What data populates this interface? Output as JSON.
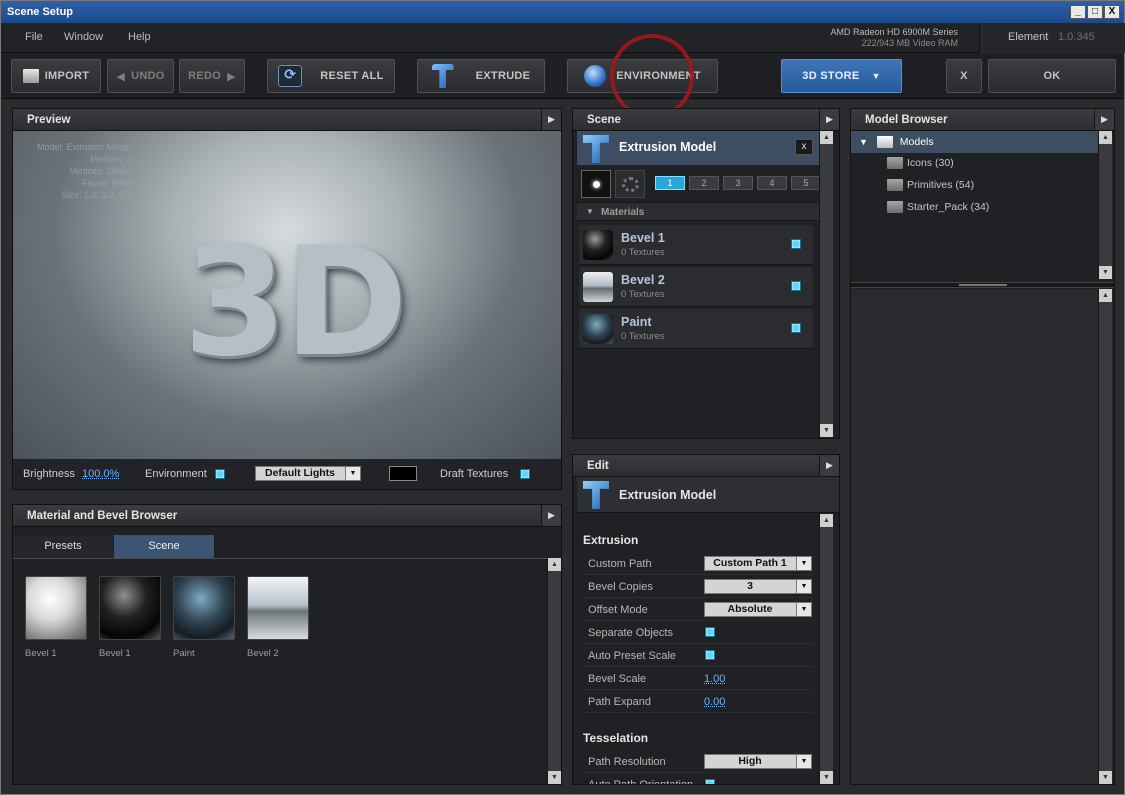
{
  "window": {
    "title": "Scene Setup",
    "controls": [
      "_",
      "□",
      "X"
    ]
  },
  "menu": {
    "items": [
      "File",
      "Window",
      "Help"
    ]
  },
  "gpu": {
    "name": "AMD Radeon HD 6900M Series",
    "memory": "222/943 MB Video RAM"
  },
  "app": {
    "name": "Element",
    "version": "1.0.345"
  },
  "toolbar": {
    "import": "IMPORT",
    "undo": "UNDO",
    "redo": "REDO",
    "reset_all": "RESET ALL",
    "extrude": "EXTRUDE",
    "environment": "ENVIRONMENT",
    "store": "3D STORE",
    "close": "X",
    "ok": "OK"
  },
  "preview": {
    "title": "Preview",
    "stats": [
      "Model: Extrusion Mode.",
      "Meshes: 2",
      "Vertices: 28664",
      "Faces: 9968",
      "Size: 1.0, 1.2, 0.2"
    ],
    "center_text": "3D",
    "brightness_label": "Brightness",
    "brightness_value": "100.0%",
    "environment_label": "Environment",
    "lights_select": "Default Lights",
    "draft_label": "Draft Textures"
  },
  "mat_browser": {
    "title": "Material and Bevel Browser",
    "tabs": [
      "Presets",
      "Scene"
    ],
    "items": [
      {
        "name": "Bevel 1",
        "style": "white"
      },
      {
        "name": "Bevel 1",
        "style": "black"
      },
      {
        "name": "Paint",
        "style": "paint"
      },
      {
        "name": "Bevel 2",
        "style": "chrome"
      }
    ]
  },
  "scene": {
    "title": "Scene",
    "model_name": "Extrusion Model",
    "close": "x",
    "numbers": [
      "1",
      "2",
      "3",
      "4",
      "5"
    ],
    "materials_label": "Materials",
    "materials": [
      {
        "name": "Bevel 1",
        "sub": "0 Textures"
      },
      {
        "name": "Bevel 2",
        "sub": "0 Textures"
      },
      {
        "name": "Paint",
        "sub": "0 Textures"
      }
    ]
  },
  "edit": {
    "title": "Edit",
    "model_name": "Extrusion Model",
    "extrusion_label": "Extrusion",
    "rows": [
      {
        "label": "Custom Path",
        "value": "Custom Path 1",
        "kind": "dropdown"
      },
      {
        "label": "Bevel Copies",
        "value": "3",
        "kind": "dropdown"
      },
      {
        "label": "Offset Mode",
        "value": "Absolute",
        "kind": "dropdown"
      },
      {
        "label": "Separate Objects",
        "value": "",
        "kind": "check"
      },
      {
        "label": "Auto Preset Scale",
        "value": "",
        "kind": "check"
      },
      {
        "label": "Bevel Scale",
        "value": "1.00",
        "kind": "number"
      },
      {
        "label": "Path Expand",
        "value": "0.00",
        "kind": "number"
      }
    ],
    "tesselation_label": "Tesselation",
    "tess_rows": [
      {
        "label": "Path Resolution",
        "value": "High",
        "kind": "dropdown"
      },
      {
        "label": "Auto Path Orientation",
        "value": "",
        "kind": "check"
      }
    ]
  },
  "model_browser": {
    "title": "Model Browser",
    "root": "Models",
    "folders": [
      "Icons (30)",
      "Primitives (54)",
      "Starter_Pack (34)"
    ]
  },
  "colors": {
    "accent": "#2a5c9c",
    "check": "#53d6ff",
    "annotation": "#b3191c"
  }
}
